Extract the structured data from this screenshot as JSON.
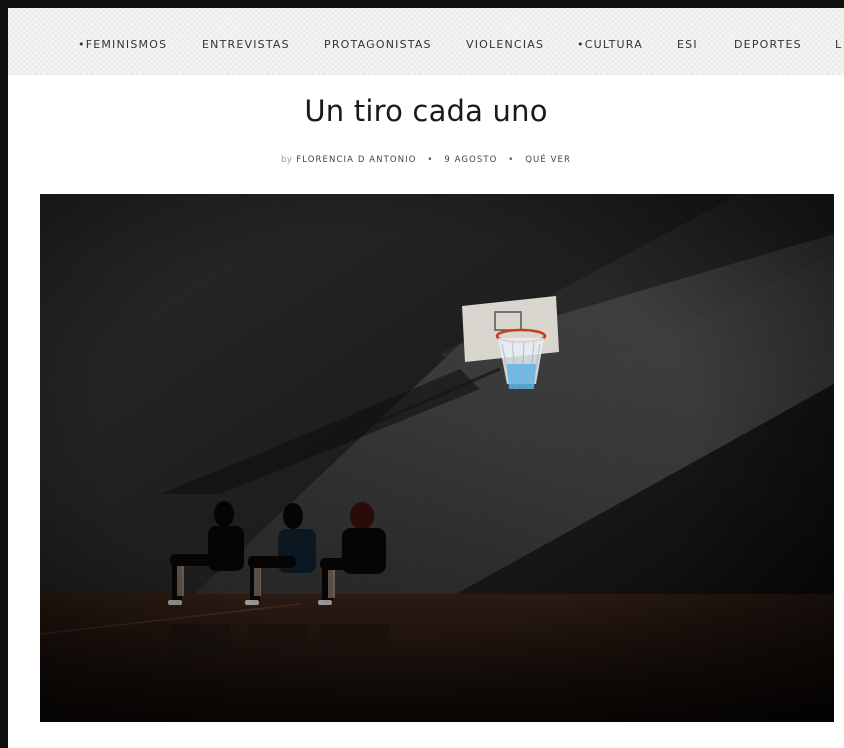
{
  "nav": {
    "items": [
      "•FEMINISMOS",
      "ENTREVISTAS",
      "PROTAGONISTAS",
      "VIOLENCIAS",
      "•CULTURA",
      "ESI",
      "DEPORTES",
      "L"
    ]
  },
  "article": {
    "title": "Un tiro cada uno",
    "byline": {
      "by": "by",
      "author": "FLORENCIA D ANTONIO",
      "separator": "•",
      "date": "9 AGOSTO",
      "category": "QUÉ VER"
    }
  },
  "photo": {
    "icon": "photo-basketball-court"
  }
}
